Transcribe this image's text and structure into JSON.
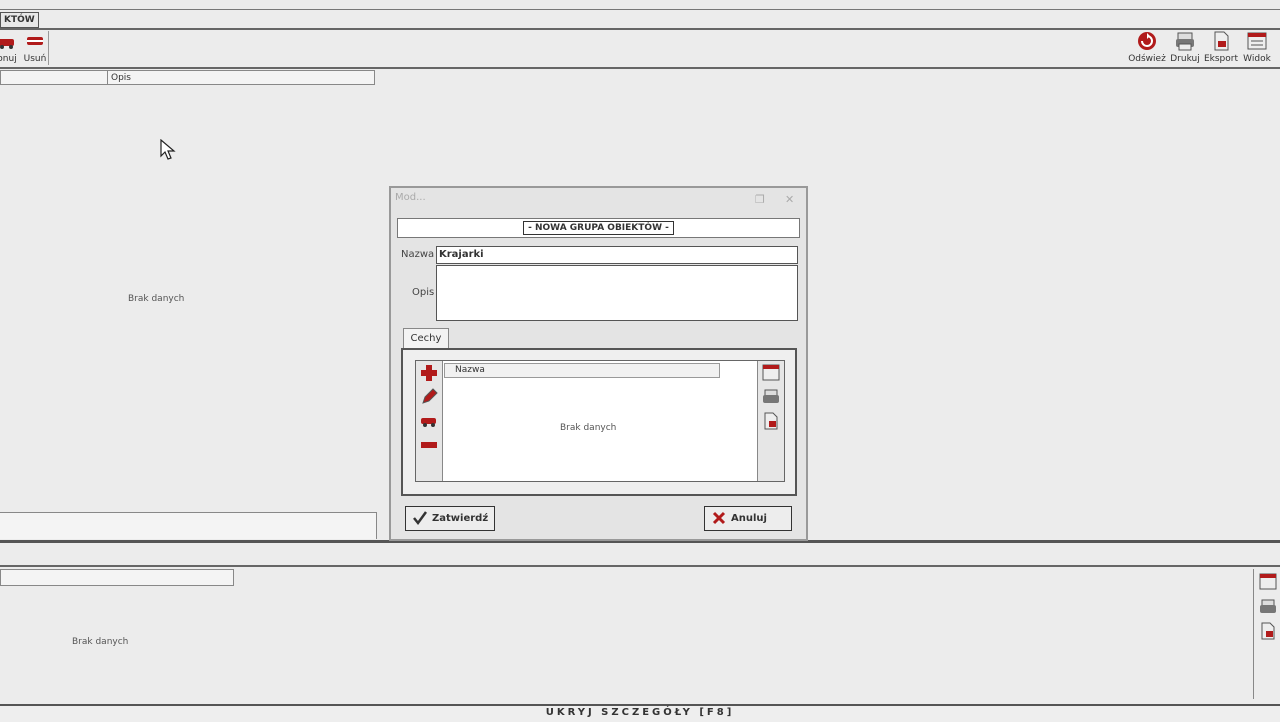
{
  "top_tab": {
    "label": "KTÓW"
  },
  "toolbar_left": [
    {
      "label": "onuj",
      "icon": "car-icon"
    },
    {
      "label": "Usuń",
      "icon": "remove-icon"
    }
  ],
  "toolbar_right": [
    {
      "label": "Odśwież",
      "icon": "refresh-icon"
    },
    {
      "label": "Drukuj",
      "icon": "print-icon"
    },
    {
      "label": "Eksport",
      "icon": "export-icon"
    },
    {
      "label": "Widok",
      "icon": "view-icon"
    }
  ],
  "main_list": {
    "column_header": "Opis",
    "empty_text": "Brak danych"
  },
  "modal": {
    "title": "Mod...",
    "header": "- NOWA GRUPA OBIEKTÓW -",
    "name_label": "Nazwa",
    "name_value": "Krajarki",
    "desc_label": "Opis",
    "desc_value": "",
    "tab_label": "Cechy",
    "grid_header": "Nazwa",
    "grid_empty": "Brak danych",
    "confirm_label": "Zatwierdź",
    "cancel_label": "Anuluj"
  },
  "lower_list": {
    "empty_text": "Brak danych"
  },
  "status_bar": {
    "label": "UKRYJ SZCZEGÓŁY [F8]"
  },
  "colors": {
    "accent_red": "#b11b1b",
    "background": "#ececec"
  }
}
